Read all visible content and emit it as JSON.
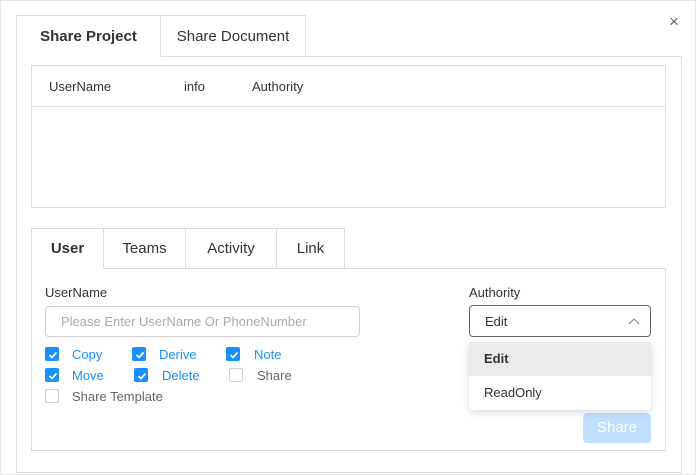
{
  "dialog": {
    "close_glyph": "×"
  },
  "top_tabs": [
    {
      "label": "Share Project",
      "active": true
    },
    {
      "label": "Share Document",
      "active": false
    }
  ],
  "table": {
    "columns": [
      "UserName",
      "info",
      "Authority"
    ],
    "rows": []
  },
  "inner_tabs": [
    {
      "label": "User",
      "active": true
    },
    {
      "label": "Teams",
      "active": false
    },
    {
      "label": "Activity",
      "active": false
    },
    {
      "label": "Link",
      "active": false
    }
  ],
  "form": {
    "username_label": "UserName",
    "username_placeholder": "Please Enter UserName Or PhoneNumber",
    "username_value": "",
    "authority_label": "Authority",
    "authority_value": "Edit",
    "authority_options": [
      {
        "label": "Edit",
        "selected": true
      },
      {
        "label": "ReadOnly",
        "selected": false
      }
    ],
    "permissions": [
      {
        "label": "Copy",
        "checked": true
      },
      {
        "label": "Derive",
        "checked": true
      },
      {
        "label": "Note",
        "checked": true
      },
      {
        "label": "Move",
        "checked": true
      },
      {
        "label": "Delete",
        "checked": true
      },
      {
        "label": "Share",
        "checked": false
      },
      {
        "label": "Share Template",
        "checked": false
      }
    ],
    "share_button": "Share"
  },
  "colors": {
    "accent": "#1890ff",
    "share_button_disabled": "#bfdfff",
    "border": "#dcdcdc"
  }
}
